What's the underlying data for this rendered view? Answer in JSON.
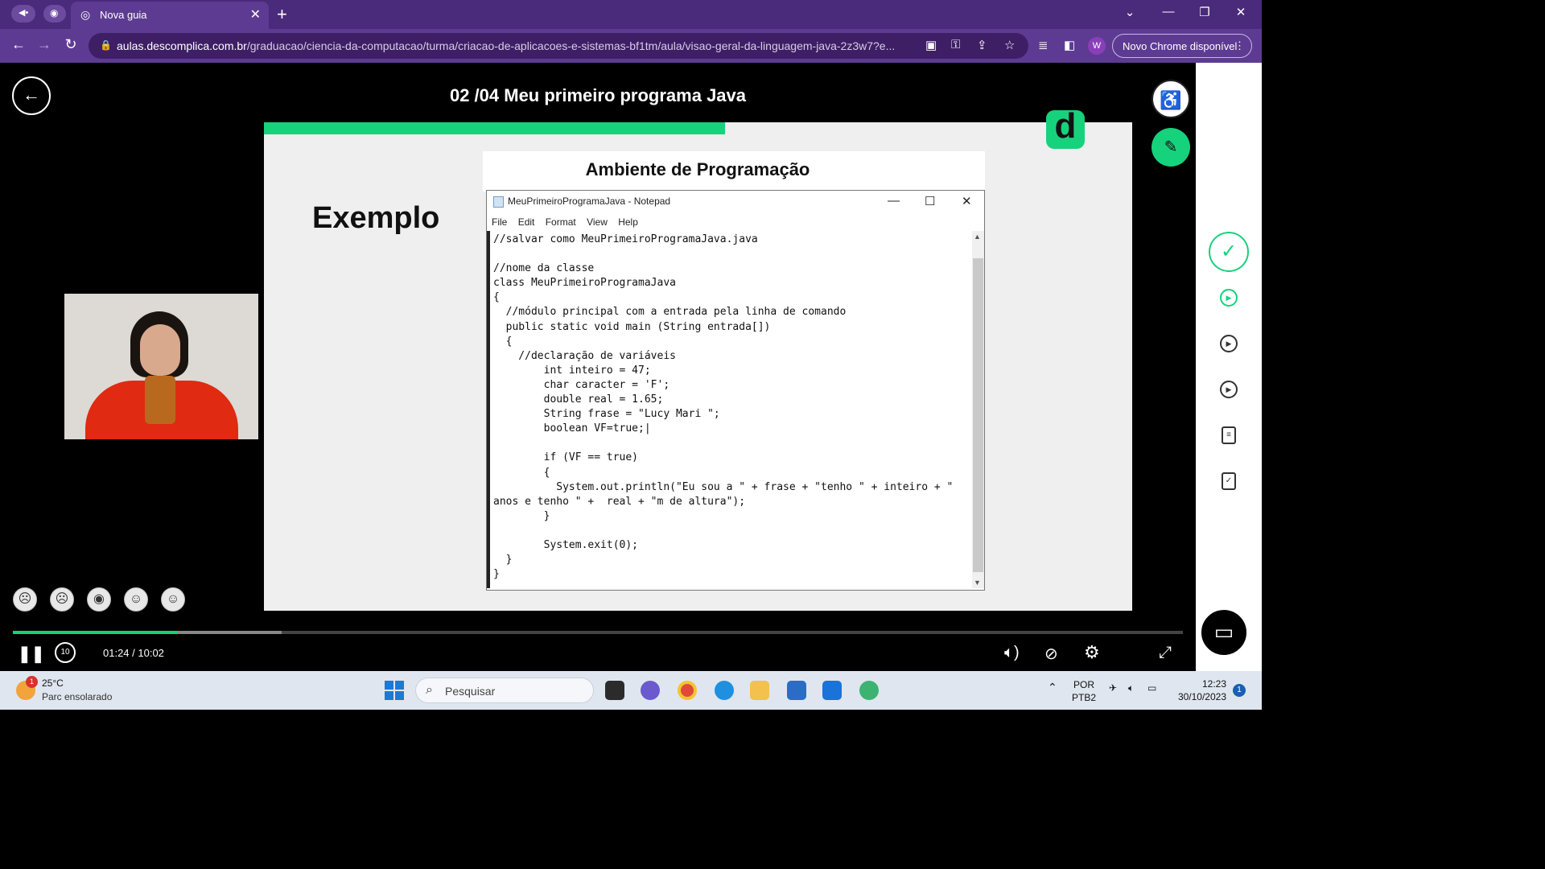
{
  "browser": {
    "tab_title": "Nova guia",
    "url_domain": "aulas.descomplica.com.br",
    "url_path": "/graduacao/ciencia-da-computacao/turma/criacao-de-aplicacoes-e-sistemas-bf1tm/aula/visao-geral-da-linguagem-java-2z3w7?e...",
    "profile_initial": "W",
    "update_label": "Novo Chrome disponível"
  },
  "player": {
    "lesson_title": "02 /04 Meu primeiro programa Java",
    "current_time": "01:24 / 10:02",
    "progress_fraction": 0.14,
    "skip_label": "10"
  },
  "slide": {
    "heading": "Exemplo",
    "environment_title": "Ambiente de Programação",
    "logo_letter": "d"
  },
  "notepad": {
    "title": "MeuPrimeiroProgramaJava - Notepad",
    "menu": [
      "File",
      "Edit",
      "Format",
      "View",
      "Help"
    ],
    "code": "//salvar como MeuPrimeiroProgramaJava.java\n\n//nome da classe\nclass MeuPrimeiroProgramaJava\n{\n  //módulo principal com a entrada pela linha de comando\n  public static void main (String entrada[])\n  {\n    //declaração de variáveis\n        int inteiro = 47;\n        char caracter = 'F';\n        double real = 1.65;\n        String frase = \"Lucy Mari \";\n        boolean VF=true;|\n\n        if (VF == true)\n        {\n          System.out.println(\"Eu sou a \" + frase + \"tenho \" + inteiro + \"\nanos e tenho \" +  real + \"m de altura\");\n        }\n\n        System.exit(0);\n  }\n}"
  },
  "taskbar": {
    "temperature": "25°C",
    "weather": "Parc ensolarado",
    "weather_badge": "1",
    "search_placeholder": "Pesquisar",
    "lang_top": "POR",
    "lang_bottom": "PTB2",
    "time": "12:23",
    "date": "30/10/2023",
    "notifications": "1"
  },
  "colors": {
    "accent_green": "#17d27c",
    "chrome_purple": "#5e3b92"
  }
}
